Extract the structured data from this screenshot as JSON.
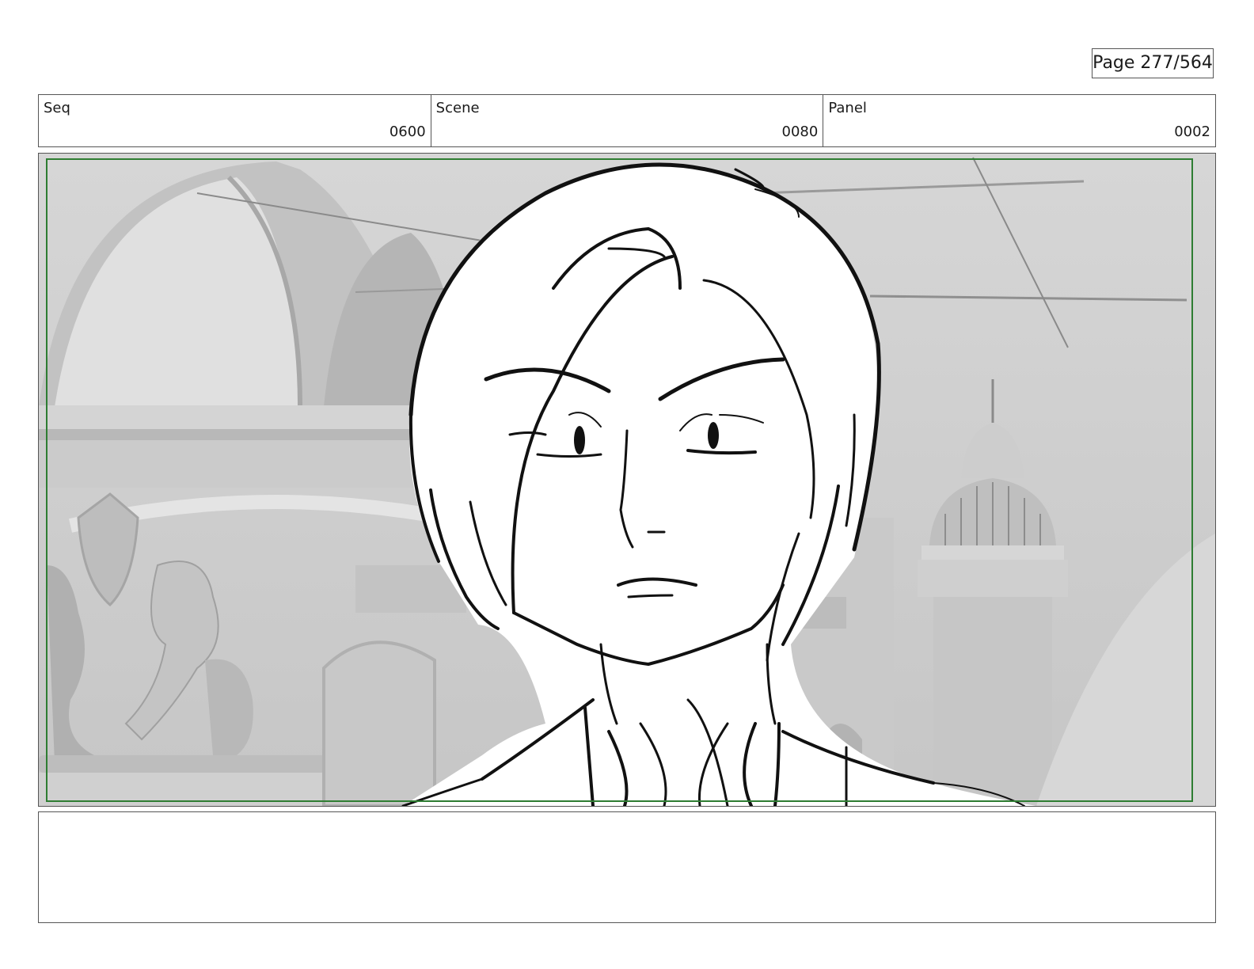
{
  "page": {
    "label": "Page 277/564"
  },
  "header": {
    "seq": {
      "label": "Seq",
      "value": "0600"
    },
    "scene": {
      "label": "Scene",
      "value": "0080"
    },
    "panel": {
      "label": "Panel",
      "value": "0002"
    }
  },
  "colors": {
    "safe_frame": "#2e7d32",
    "border": "#555555",
    "background_render": "#cfcfcf"
  },
  "notes": {
    "text": ""
  }
}
